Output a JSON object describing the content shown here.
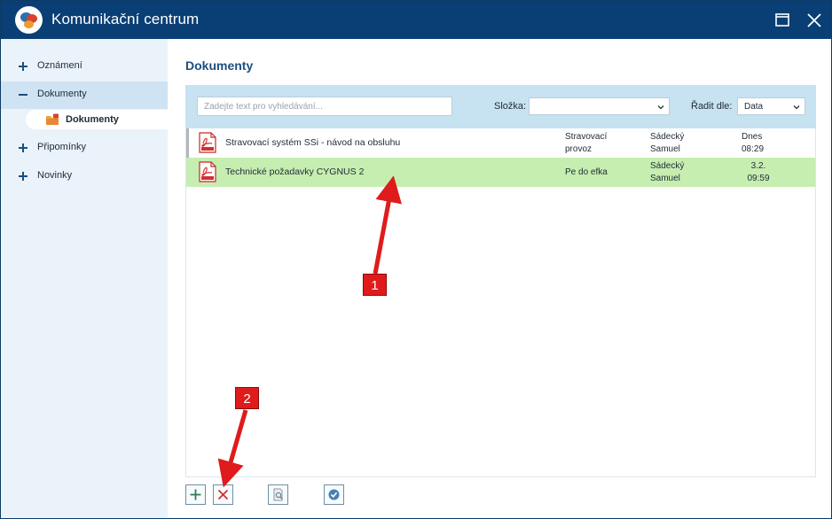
{
  "window": {
    "title": "Komunikační centrum",
    "colors": {
      "titlebar": "#0a3f75",
      "sidebar": "#eaf2fa",
      "sidebar_active": "#cfe3f3",
      "toolbar": "#c7e2f1",
      "row_selected": "#c6eeb0",
      "title": "#1a4f7d",
      "annotation": "#e01b1b"
    }
  },
  "titlebar": {
    "logo_icon": "chat-bubbles-logo-icon",
    "maximize_icon": "maximize-icon",
    "close_icon": "close-icon"
  },
  "sidebar": {
    "items": [
      {
        "sign": "+",
        "label": "Oznámení"
      },
      {
        "sign": "−",
        "label": "Dokumenty",
        "active": true
      },
      {
        "sign": "+",
        "label": "Připomínky"
      },
      {
        "sign": "+",
        "label": "Novinky"
      }
    ],
    "subitem": {
      "label": "Dokumenty",
      "icon": "folder-icon"
    }
  },
  "main": {
    "title": "Dokumenty",
    "search": {
      "placeholder": "Zadejte text pro vyhledávání...",
      "value": ""
    },
    "folder": {
      "label": "Složka:",
      "value": ""
    },
    "sort": {
      "label": "Řadit dle:",
      "value": "Data"
    }
  },
  "documents": [
    {
      "name": "Stravovací systém SSi - návod na obsluhu",
      "folder_line1": "Stravovací",
      "folder_line2": "provoz",
      "author_line1": "Sádecký",
      "author_line2": "Samuel",
      "date_line1": "Dnes",
      "date_line2": "08:29",
      "selected": false
    },
    {
      "name": "Technické požadavky CYGNUS 2",
      "folder_line1": "Pe do efka",
      "folder_line2": "",
      "author_line1": "Sádecký",
      "author_line2": "Samuel",
      "date_line1": "3.2.",
      "date_line2": "09:59",
      "selected": true
    }
  ],
  "bottom_toolbar": {
    "buttons": [
      {
        "name": "add-button",
        "icon": "plus-icon"
      },
      {
        "name": "delete-button",
        "icon": "x-icon"
      },
      {
        "name": "preview-button",
        "icon": "document-search-icon"
      },
      {
        "name": "confirm-button",
        "icon": "checkmark-icon"
      }
    ]
  },
  "annotations": {
    "badge_1": "1",
    "badge_2": "2"
  }
}
